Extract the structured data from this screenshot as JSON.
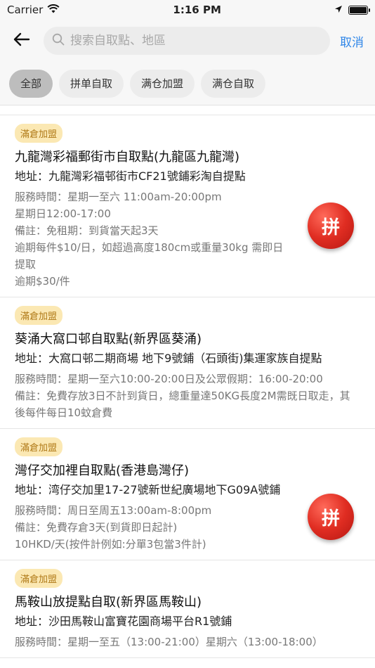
{
  "status_bar": {
    "carrier": "Carrier",
    "time": "1:16 PM"
  },
  "header": {
    "search_placeholder": "搜索自取點、地區",
    "cancel_label": "取消"
  },
  "filters": [
    {
      "label": "全部",
      "active": true
    },
    {
      "label": "拼单自取",
      "active": false
    },
    {
      "label": "满仓加盟",
      "active": false
    },
    {
      "label": "满仓自取",
      "active": false
    }
  ],
  "pickup_points": [
    {
      "badge": "滿倉加盟",
      "title": "九龍灣彩福郵街市自取點(九龍區九龍灣)",
      "address": "地址：九龍灣彩福邨街市CF21號鋪彩淘自提點",
      "meta": [
        "服務時間：星期一至六 11:00am-20:00pm",
        "星期日12:00-17:00",
        "備註：免租期：到貨當天起3天",
        "逾期每件$10/日，如超過高度180cm或重量30kg 需即日提取",
        "逾期$30/件"
      ],
      "pin_label": "拼"
    },
    {
      "badge": "滿倉加盟",
      "title": "葵涌大窩口邨自取點(新界區葵涌)",
      "address": "地址：大窩口邨二期商場 地下9號鋪（石頭街)集運家族自提點",
      "meta": [
        "服務時間：星期一至六10:00-20:00日及公眾假期：16:00-20:00",
        "備註：免費存放3日不計到貨日，總重量達50KG長度2M需既日取走，其後每件每日10蚊倉費"
      ],
      "pin_label": ""
    },
    {
      "badge": "滿倉加盟",
      "title": "灣仔交加裡自取點(香港島灣仔)",
      "address": "地址：湾仔交加里17-27號新世紀廣場地下G09A號鋪",
      "meta": [
        "服務時間：周日至周五13:00am-8:00pm",
        "備註：免費存倉3天(到貨即日起計)",
        "10HKD/天(按件計例如:分單3包當3件計)"
      ],
      "pin_label": "拼"
    },
    {
      "badge": "滿倉加盟",
      "title": "馬鞍山放提點自取(新界區馬鞍山)",
      "address": "地址：沙田馬鞍山富寶花園商場平台R1號鋪",
      "meta": [
        "服務時間：星期一至五（13:00-21:00）星期六（13:00-18:00）"
      ],
      "pin_label": ""
    }
  ]
}
